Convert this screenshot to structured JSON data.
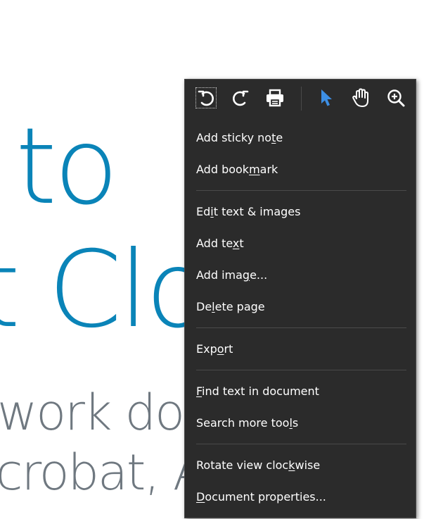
{
  "document": {
    "line1": "to",
    "line2": "t Clo",
    "line3": "work done",
    "line4": "crobat, Ad"
  },
  "toolbar": {
    "items": [
      {
        "icon": "rotate-counterclockwise-icon"
      },
      {
        "icon": "rotate-clockwise-icon"
      },
      {
        "icon": "print-icon"
      },
      {
        "icon": "select-cursor-icon",
        "color": "#3d8fe5"
      },
      {
        "icon": "hand-tool-icon"
      },
      {
        "icon": "zoom-in-icon"
      }
    ]
  },
  "menu": {
    "items": [
      {
        "pre": "Add sticky no",
        "u": "t",
        "post": "e"
      },
      {
        "pre": "Add book",
        "u": "m",
        "post": "ark"
      },
      {
        "pre": "Ed",
        "u": "i",
        "post": "t text & images"
      },
      {
        "pre": "Add te",
        "u": "x",
        "post": "t"
      },
      {
        "pre": "Add ima",
        "u": "g",
        "post": "e..."
      },
      {
        "pre": "De",
        "u": "l",
        "post": "ete page"
      },
      {
        "pre": "Exp",
        "u": "o",
        "post": "rt"
      },
      {
        "pre": "",
        "u": "F",
        "post": "ind text in document"
      },
      {
        "pre": "Search more too",
        "u": "l",
        "post": "s"
      },
      {
        "pre": "Rotate view cloc",
        "u": "k",
        "post": "wise"
      },
      {
        "pre": "",
        "u": "D",
        "post": "ocument properties..."
      }
    ]
  }
}
